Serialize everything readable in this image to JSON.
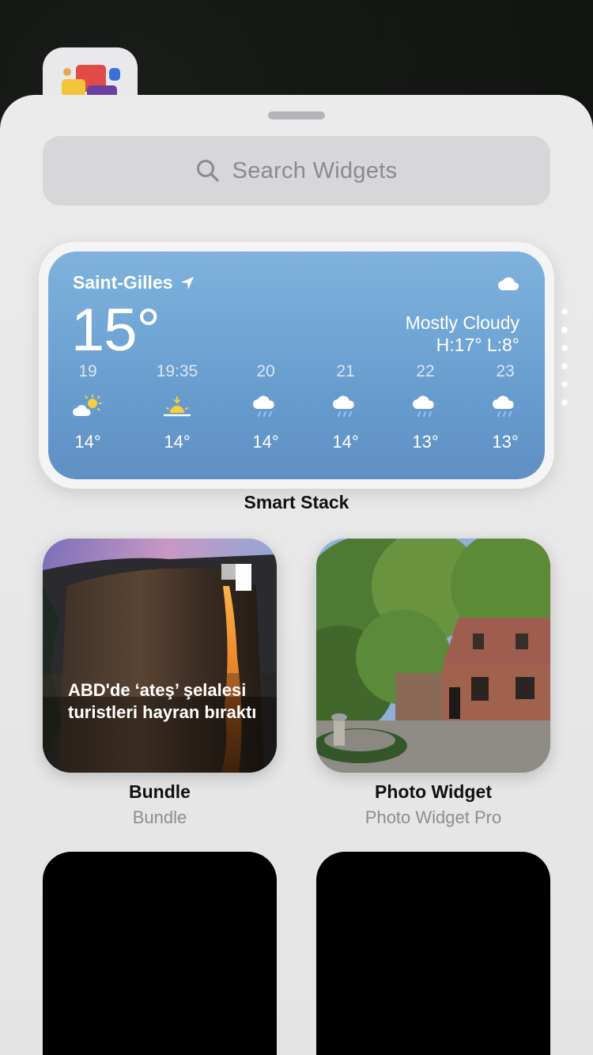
{
  "search": {
    "placeholder": "Search Widgets"
  },
  "weather": {
    "city": "Saint-Gilles",
    "temp": "15°",
    "condition": "Mostly Cloudy",
    "high_low": "H:17° L:8°",
    "hourly": [
      {
        "time": "19",
        "icon": "partly-cloudy-icon",
        "temp": "14°"
      },
      {
        "time": "19:35",
        "icon": "sunset-icon",
        "temp": "14°"
      },
      {
        "time": "20",
        "icon": "rain-icon",
        "temp": "14°"
      },
      {
        "time": "21",
        "icon": "rain-icon",
        "temp": "14°"
      },
      {
        "time": "22",
        "icon": "rain-icon",
        "temp": "13°"
      },
      {
        "time": "23",
        "icon": "rain-icon",
        "temp": "13°"
      }
    ]
  },
  "smart_stack": {
    "label": "Smart Stack"
  },
  "widgets": [
    {
      "name": "Bundle",
      "sub": "Bundle",
      "headline": "ABD'de ‘ateş’ şelalesi turistleri hayran bıraktı"
    },
    {
      "name": "Photo Widget",
      "sub": "Photo Widget Pro"
    }
  ],
  "colors": {
    "sheet": "#ebebeb",
    "weather_top": "#7fb3dd",
    "weather_bottom": "#5f8fc3"
  }
}
